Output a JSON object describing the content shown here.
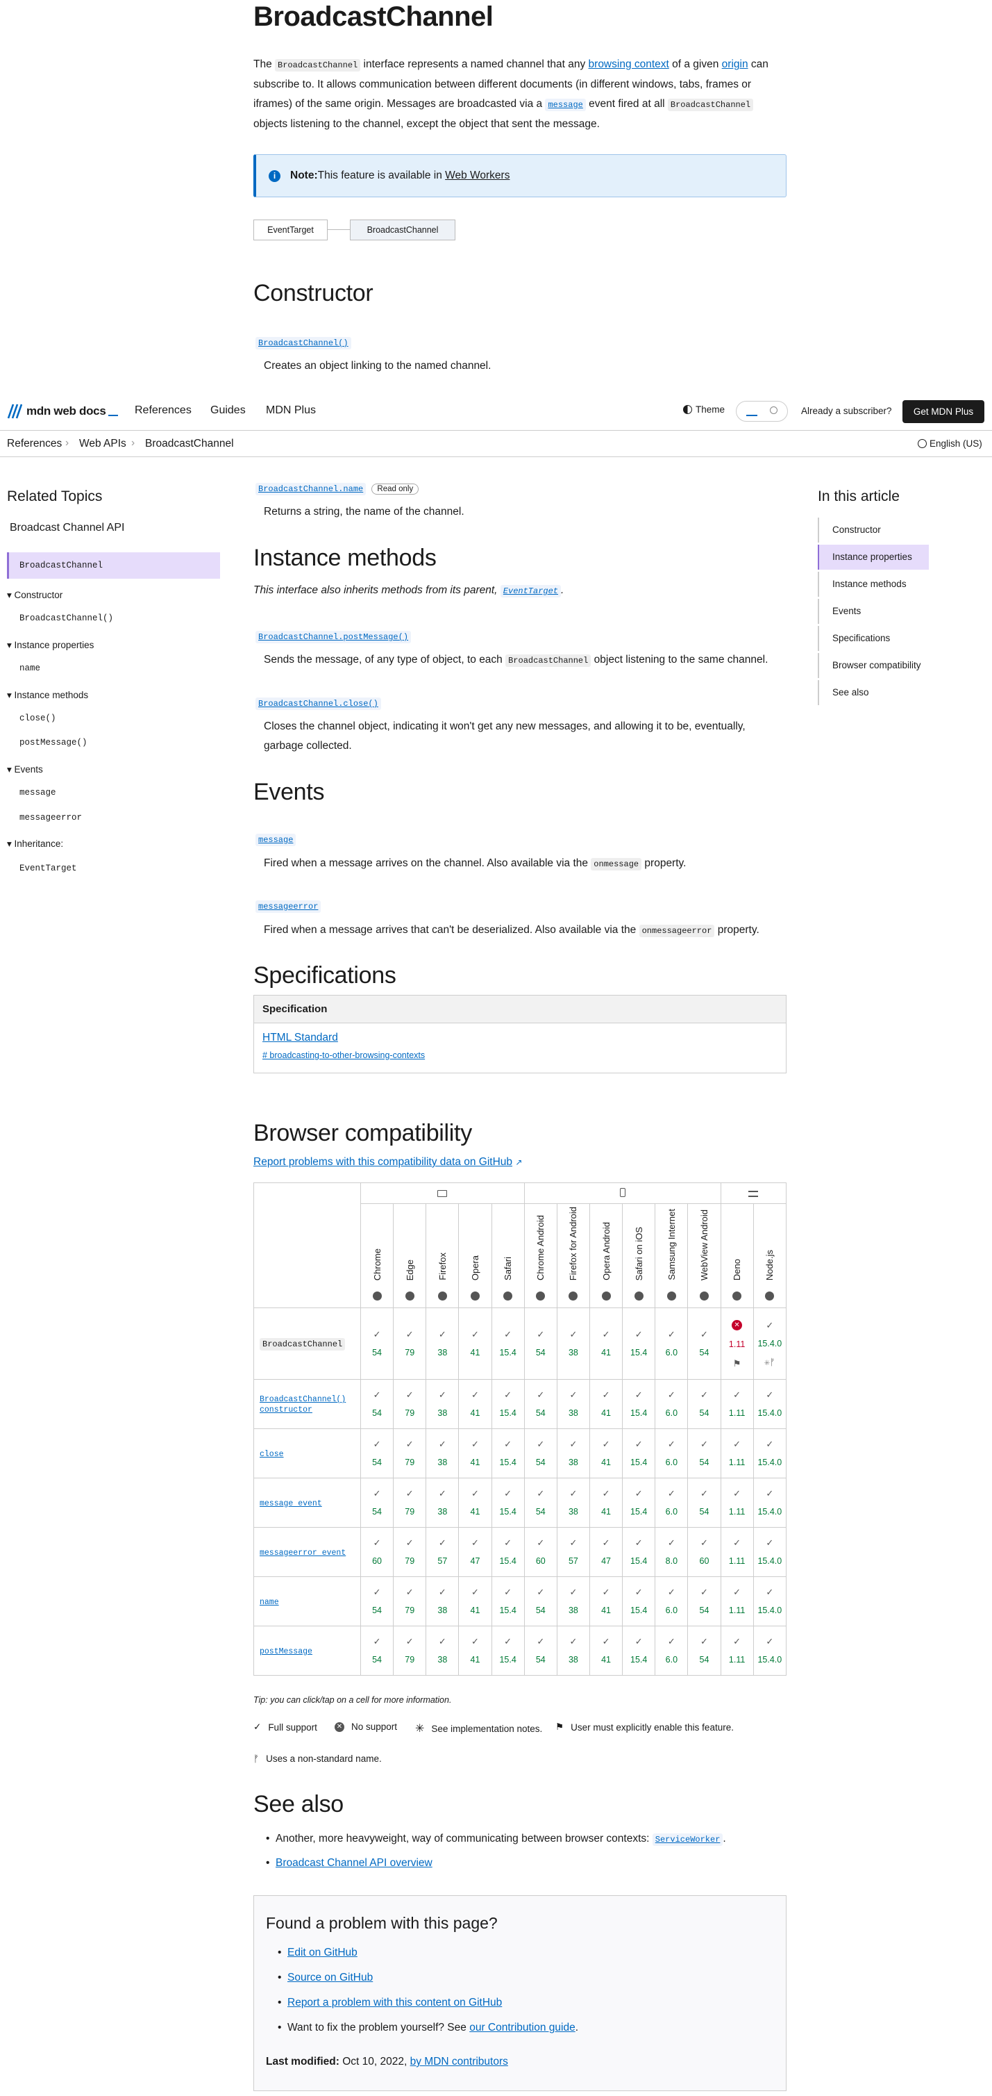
{
  "page": {
    "title": "BroadcastChannel",
    "intro": {
      "t1": "The ",
      "code1": "BroadcastChannel",
      "t2": " interface represents a named channel that any ",
      "link1": "browsing context",
      "t3": " of a given ",
      "link2": "origin",
      "t4": " can",
      "line2": "subscribe to. It allows communication between different documents (in different windows, tabs, frames or",
      "line3a": "iframes) of the same origin. Messages are broadcasted via a ",
      "code2": "message",
      "line3b": " event fired at all ",
      "code3": "BroadcastChannel",
      "line4": "objects listening to the channel, except the object that sent the message."
    },
    "note": {
      "label": "Note:",
      "text": " This feature is available in ",
      "link": "Web Workers"
    },
    "inheritance": [
      "EventTarget",
      "BroadcastChannel"
    ]
  },
  "constructor": {
    "heading": "Constructor",
    "term": "BroadcastChannel()",
    "desc": "Creates an object linking to the named channel."
  },
  "header": {
    "logo": "mdn web docs",
    "nav": [
      "References",
      "Guides",
      "MDN Plus"
    ],
    "theme": "Theme",
    "subscriber": "Already a subscriber?",
    "cta": "Get MDN Plus"
  },
  "breadcrumb": {
    "items": [
      "References",
      "Web APIs",
      "BroadcastChannel"
    ],
    "language": "English (US)"
  },
  "sidebar": {
    "title": "Related Topics",
    "api": "Broadcast Channel API",
    "active": "BroadcastChannel",
    "groups": [
      {
        "label": "Constructor",
        "items": [
          "BroadcastChannel()"
        ]
      },
      {
        "label": "Instance properties",
        "items": [
          "name"
        ]
      },
      {
        "label": "Instance methods",
        "items": [
          "close()",
          "postMessage()"
        ]
      },
      {
        "label": "Events",
        "items": [
          "message",
          "messageerror"
        ]
      },
      {
        "label": "Inheritance:",
        "items": [
          "EventTarget"
        ]
      }
    ]
  },
  "toc": {
    "title": "In this article",
    "items": [
      "Constructor",
      "Instance properties",
      "Instance methods",
      "Events",
      "Specifications",
      "Browser compatibility",
      "See also"
    ]
  },
  "properties": {
    "term": "BroadcastChannel.name",
    "badge": "Read only",
    "desc": "Returns a string, the name of the channel."
  },
  "methods": {
    "heading": "Instance methods",
    "inherit_text": "This interface also inherits methods from its parent, ",
    "inherit_link": "EventTarget",
    "inherit_end": ".",
    "m1_term": "BroadcastChannel.postMessage()",
    "m1_desc_a": "Sends the message, of any type of object, to each ",
    "m1_desc_code": "BroadcastChannel",
    "m1_desc_b": " object listening to the same channel.",
    "m2_term": "BroadcastChannel.close()",
    "m2_desc_1": "Closes the channel object, indicating it won't get any new messages, and allowing it to be, eventually,",
    "m2_desc_2": "garbage collected."
  },
  "events": {
    "heading": "Events",
    "e1_term": "message",
    "e1_desc_a": "Fired when a message arrives on the channel. Also available via the ",
    "e1_code": "onmessage",
    "e1_desc_b": " property.",
    "e2_term": "messageerror",
    "e2_desc_a": "Fired when a message arrives that can't be deserialized. Also available via the ",
    "e2_code": "onmessageerror",
    "e2_desc_b": " property."
  },
  "specs": {
    "heading": "Specifications",
    "col": "Specification",
    "link": "HTML Standard",
    "anchor": "# broadcasting-to-other-browsing-contexts"
  },
  "compat": {
    "heading": "Browser compatibility",
    "report": "Report problems with this compatibility data on GitHub",
    "browsers": [
      "Chrome",
      "Edge",
      "Firefox",
      "Opera",
      "Safari",
      "Chrome Android",
      "Firefox for Android",
      "Opera Android",
      "Safari on iOS",
      "Samsung Internet",
      "WebView Android",
      "Deno",
      "Node.js"
    ],
    "rows": [
      {
        "feature": "BroadcastChannel",
        "values": [
          "54",
          "79",
          "38",
          "41",
          "15.4",
          "54",
          "38",
          "41",
          "15.4",
          "6.0",
          "54",
          "1.11",
          "15.4.0"
        ]
      },
      {
        "feature": "BroadcastChannel() constructor",
        "values": [
          "54",
          "79",
          "38",
          "41",
          "15.4",
          "54",
          "38",
          "41",
          "15.4",
          "6.0",
          "54",
          "1.11",
          "15.4.0"
        ]
      },
      {
        "feature": "close",
        "values": [
          "54",
          "79",
          "38",
          "41",
          "15.4",
          "54",
          "38",
          "41",
          "15.4",
          "6.0",
          "54",
          "1.11",
          "15.4.0"
        ]
      },
      {
        "feature": "message event",
        "values": [
          "54",
          "79",
          "38",
          "41",
          "15.4",
          "54",
          "38",
          "41",
          "15.4",
          "6.0",
          "54",
          "1.11",
          "15.4.0"
        ]
      },
      {
        "feature": "messageerror event",
        "values": [
          "60",
          "79",
          "57",
          "47",
          "15.4",
          "60",
          "57",
          "47",
          "15.4",
          "8.0",
          "60",
          "1.11",
          "15.4.0"
        ]
      },
      {
        "feature": "name",
        "values": [
          "54",
          "79",
          "38",
          "41",
          "15.4",
          "54",
          "38",
          "41",
          "15.4",
          "6.0",
          "54",
          "1.11",
          "15.4.0"
        ]
      },
      {
        "feature": "postMessage",
        "values": [
          "54",
          "79",
          "38",
          "41",
          "15.4",
          "54",
          "38",
          "41",
          "15.4",
          "6.0",
          "54",
          "1.11",
          "15.4.0"
        ]
      }
    ],
    "tip": "Tip: you can click/tap on a cell for more information.",
    "legend": [
      "Full support",
      "No support",
      "See implementation notes.",
      "User must explicitly enable this feature.",
      "Uses a non-standard name."
    ]
  },
  "see_also": {
    "heading": "See also",
    "item1_text": "Another, more heavyweight, way of communicating between browser contexts: ",
    "item1_code": "ServiceWorker",
    "item1_end": ".",
    "item2": "Broadcast Channel API overview"
  },
  "feedback": {
    "heading": "Found a problem with this page?",
    "links": [
      "Edit on GitHub",
      "Source on GitHub",
      "Report a problem with this content on GitHub"
    ],
    "fix_text": "Want to fix the problem yourself? See ",
    "fix_link": "our Contribution guide",
    "fix_end": ".",
    "modified_label": "Last modified:",
    "modified_date": " Oct 10, 2022, ",
    "modified_link": "by MDN contributors"
  },
  "colors": {
    "accent": "#0069c2",
    "sidebar_active": "#e6dcfb",
    "support_green": "#007936",
    "no_support_red": "#c4002b",
    "note_bg": "#e3f0fb"
  }
}
